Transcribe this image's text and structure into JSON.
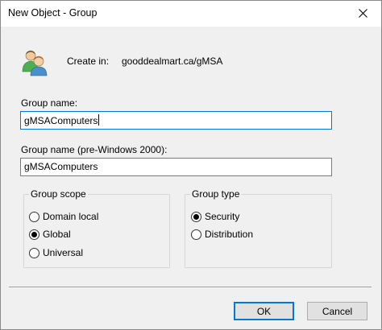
{
  "window": {
    "title": "New Object - Group"
  },
  "header": {
    "create_in_label": "Create in:",
    "create_in_path": "gooddealmart.ca/gMSA"
  },
  "icons": {
    "group": "group-users-icon",
    "close": "close-icon"
  },
  "fields": {
    "group_name": {
      "label": "Group name:",
      "value": "gMSAComputers"
    },
    "group_name_pre2000": {
      "label": "Group name (pre-Windows 2000):",
      "value": "gMSAComputers"
    }
  },
  "group_scope": {
    "title": "Group scope",
    "options": [
      "Domain local",
      "Global",
      "Universal"
    ],
    "selected": "Global"
  },
  "group_type": {
    "title": "Group type",
    "options": [
      "Security",
      "Distribution"
    ],
    "selected": "Security"
  },
  "buttons": {
    "ok": "OK",
    "cancel": "Cancel"
  },
  "colors": {
    "focus_accent": "#0078d7",
    "dialog_bg": "#f0f0f0"
  }
}
